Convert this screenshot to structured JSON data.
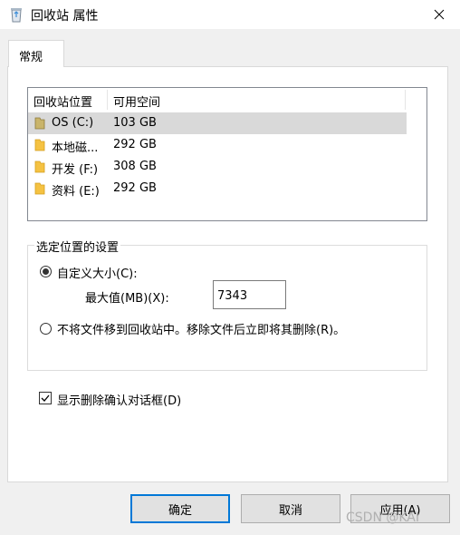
{
  "window": {
    "title": "回收站 属性",
    "close_icon": "close-icon"
  },
  "tabs": [
    {
      "label": "常规",
      "selected": true
    }
  ],
  "drives_list": {
    "columns": [
      "回收站位置",
      "可用空间"
    ],
    "rows": [
      {
        "name": "OS (C:)",
        "space": "103 GB",
        "icon": "drive-folder-icon",
        "selected": true
      },
      {
        "name": "本地磁...",
        "space": "292 GB",
        "icon": "folder-icon",
        "selected": false
      },
      {
        "name": "开发 (F:)",
        "space": "308 GB",
        "icon": "folder-icon",
        "selected": false
      },
      {
        "name": "资料 (E:)",
        "space": "292 GB",
        "icon": "folder-icon",
        "selected": false
      }
    ]
  },
  "settings": {
    "group_title": "选定位置的设置",
    "custom_size_label": "自定义大小(C):",
    "custom_size_selected": true,
    "max_value_label": "最大值(MB)(X):",
    "max_value": "7343",
    "no_move_label": "不将文件移到回收站中。移除文件后立即将其删除(R)。",
    "no_move_selected": false
  },
  "confirm_dialog": {
    "label": "显示删除确认对话框(D)",
    "checked": true
  },
  "buttons": {
    "ok": "确定",
    "cancel": "取消",
    "apply": "应用(A)"
  },
  "watermark": "CSDN @KAI",
  "colors": {
    "accent": "#0078d7",
    "folder": "#f5c242",
    "selected_row": "#d9d9d9"
  }
}
